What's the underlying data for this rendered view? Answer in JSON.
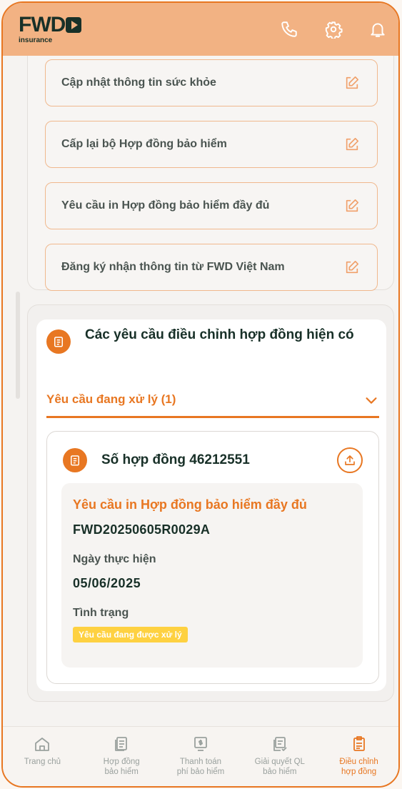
{
  "brand": {
    "name": "FWD",
    "sub": "insurance"
  },
  "colors": {
    "accent": "#e87722",
    "header_bg": "#f2b283",
    "badge": "#fed141",
    "dark": "#183028"
  },
  "header": {
    "icons": [
      "phone-icon",
      "gear-icon",
      "bell-icon"
    ]
  },
  "options": [
    {
      "label": "Cập nhật thông tin sức khỏe",
      "icon": "edit-icon"
    },
    {
      "label": "Cấp lại bộ Hợp đồng bảo hiểm",
      "icon": "edit-icon"
    },
    {
      "label": "Yêu cầu in Hợp đồng bảo hiểm đầy đủ",
      "icon": "edit-icon"
    },
    {
      "label": "Đăng ký nhận thông tin từ FWD Việt Nam",
      "icon": "edit-icon"
    }
  ],
  "requests": {
    "title": "Các yêu cầu điều chỉnh hợp đồng hiện có",
    "accordion_label": "Yêu cầu đang xử lý (1)",
    "policy": {
      "number_label": "Số hợp đồng 46212551",
      "request_title": "Yêu cầu in Hợp đồng bảo hiểm đầy đủ",
      "request_code": "FWD20250605R0029A",
      "date_label": "Ngày thực hiện",
      "date_value": "05/06/2025",
      "status_label": "Tình trạng",
      "status_value": "Yêu cầu đang được xử lý"
    }
  },
  "nav": [
    {
      "label": "Trang chủ",
      "icon": "home-icon"
    },
    {
      "label": "Hợp đồng\nbảo hiểm",
      "icon": "contract-icon"
    },
    {
      "label": "Thanh toán\nphí bảo hiểm",
      "icon": "payment-icon"
    },
    {
      "label": "Giải quyết QL\nbảo hiểm",
      "icon": "claim-icon"
    },
    {
      "label": "Điều chỉnh\nhợp đồng",
      "icon": "adjust-icon",
      "active": true
    }
  ]
}
